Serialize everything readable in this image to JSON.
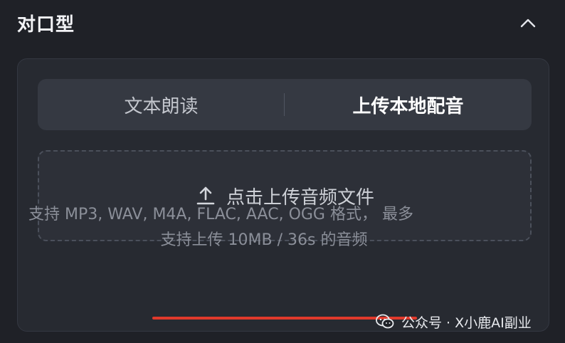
{
  "header": {
    "title": "对口型",
    "collapse_icon": "chevron-up-icon"
  },
  "tabs": [
    {
      "label": "文本朗读",
      "active": false
    },
    {
      "label": "上传本地配音",
      "active": true
    }
  ],
  "upload": {
    "icon": "upload-icon",
    "label": "点击上传音频文件"
  },
  "hint": {
    "line1": "支持 MP3, WAV, M4A, FLAC, AAC, OGG 格式，  最多",
    "line2": "支持上传 10MB / 36s 的音频"
  },
  "watermark": {
    "icon": "wechat-icon",
    "text": "公众号 · X小鹿AI副业"
  },
  "colors": {
    "background": "#1f2127",
    "panel": "#272a31",
    "tab_bar": "#353942",
    "accent_underline": "#e0392b"
  }
}
